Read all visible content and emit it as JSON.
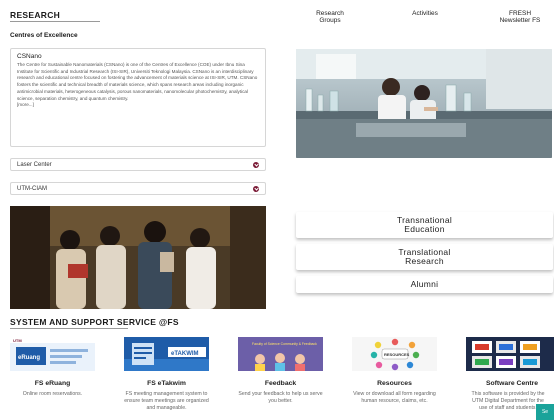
{
  "header": {
    "title": "RESEARCH",
    "nav": [
      {
        "line1": "Research",
        "line2": "Groups"
      },
      {
        "line1": "Activities",
        "line2": ""
      },
      {
        "line1": "FRESH",
        "line2": "Newsletter FS"
      }
    ]
  },
  "coe": {
    "title": "Centres of Excellence",
    "csnano": {
      "title": "CSNano",
      "body": "The Centre for Sustainable Nanomaterials (CSNano) is one of the Centres of Excellence (COE) under Ibnu Sina Institute for Scientific and Industrial Research (ISI-SIR), Universiti Teknologi Malaysia. CSNano is an interdisciplinary research and educational centre focused on fostering the advancement of materials science at ISI-SIR, UTM. CSNano fosters the scientific and technical breadth of materials science, which spans research areas including inorganic antimicrobial materials, heterogeneous catalysis, porous nanomaterials, nanomolecular photochemistry, analytical science, separation chemistry, and quantum chemistry.",
      "more": "[more...]"
    },
    "accordions": [
      "Laser Center",
      "UTM-CIAM"
    ]
  },
  "menu": [
    {
      "line1": "Transnational",
      "line2": "Education"
    },
    {
      "line1": "Translational",
      "line2": "Research"
    },
    {
      "line1": "Alumni",
      "line2": ""
    }
  ],
  "system": {
    "title": "SYSTEM AND SUPPORT SERVICE @FS",
    "services": [
      {
        "name": "FS eRuang",
        "desc": "Online room reservations.",
        "img_text": "eRuang"
      },
      {
        "name": "FS eTakwim",
        "desc": "FS meeting management system to ensure team meetings are organized and manageable.",
        "img_text": "eTAKWIM"
      },
      {
        "name": "Feedback",
        "desc": "Send your feedback to help us serve you better.",
        "img_text": "Faculty of Science Community & Feedback"
      },
      {
        "name": "Resources",
        "desc": "View or download all form regarding human resource, claims, etc.",
        "img_text": "RESOURCES"
      },
      {
        "name": "Software Centre",
        "desc": "This software is provided by the UTM Digital Department for the use of staff and students.",
        "img_text": ""
      }
    ]
  },
  "corner_button": {
    "label": "Se"
  },
  "colors": {
    "accordion_dot": "#7a1a36",
    "corner_button": "#1aa39a",
    "etakwim_blue": "#1f5ca8",
    "feedback_purple": "#6c5fa8"
  }
}
